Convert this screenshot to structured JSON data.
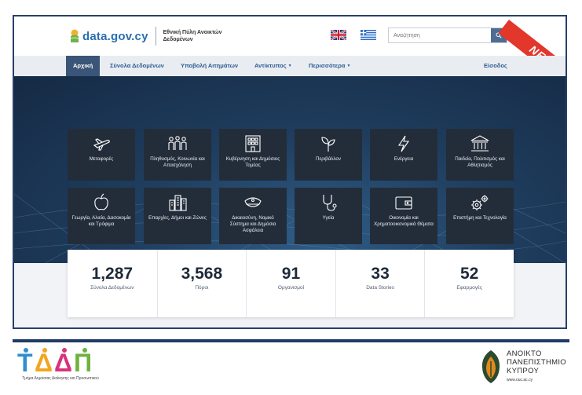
{
  "site": {
    "logo_text": "data.gov.cy",
    "logo_subtitle": "Εθνική Πύλη Ανοικτών Δεδομένων",
    "search_placeholder": "Αναζήτηση",
    "ribbon": "NEW"
  },
  "nav": {
    "items": [
      {
        "label": "Αρχική",
        "active": true
      },
      {
        "label": "Σύνολα Δεδομένων",
        "active": false
      },
      {
        "label": "Υποβολή Αιτημάτων",
        "active": false
      },
      {
        "label": "Αντίκτυπος",
        "active": false,
        "dropdown": true
      },
      {
        "label": "Περισσότερα",
        "active": false,
        "dropdown": true
      }
    ],
    "login": "Είσοδος"
  },
  "categories": [
    {
      "label": "Μεταφορές",
      "icon": "airplane-icon"
    },
    {
      "label": "Πληθυσμός, Κοινωνία και Απασχόληση",
      "icon": "people-icon"
    },
    {
      "label": "Κυβέρνηση και Δημόσιος Τομέας",
      "icon": "government-building-icon"
    },
    {
      "label": "Περιβάλλον",
      "icon": "plant-icon"
    },
    {
      "label": "Ενέργεια",
      "icon": "lightning-icon"
    },
    {
      "label": "Παιδεία, Πολιτισμός και Αθλητισμός",
      "icon": "museum-icon"
    },
    {
      "label": "Γεωργία, Αλιεία, Δασοκομία και Τρόφιμα",
      "icon": "apple-icon"
    },
    {
      "label": "Επαρχίες, Δήμοι και Ζώνες",
      "icon": "city-icon"
    },
    {
      "label": "Δικαιοσύνη, Νομικό Σύστημα και Δημόσια Ασφάλεια",
      "icon": "police-cap-icon"
    },
    {
      "label": "Υγεία",
      "icon": "stethoscope-icon"
    },
    {
      "label": "Οικονομία και Χρηματοοικονομικά Θέματα",
      "icon": "wallet-icon"
    },
    {
      "label": "Επιστήμη και Τεχνολογία",
      "icon": "gears-icon"
    }
  ],
  "stats": [
    {
      "value": "1,287",
      "label": "Σύνολα Δεδομένων"
    },
    {
      "value": "3,568",
      "label": "Πόροι"
    },
    {
      "value": "91",
      "label": "Οργανισμοί"
    },
    {
      "value": "33",
      "label": "Data Stories"
    },
    {
      "value": "52",
      "label": "Εφαρμογές"
    }
  ],
  "footer": {
    "left_logo_text": "ΤΔΔΠ",
    "left_caption": "Τμήμα Δημόσιας Διοίκησης και Προσωπικού",
    "right_name_lines": [
      "ΑΝΟΙΚΤΟ",
      "ΠΑΝΕΠΙΣΤΗΜΙΟ",
      "ΚΥΠΡΟΥ"
    ],
    "right_url": "www.ouc.ac.cy"
  },
  "colors": {
    "brand_blue": "#2a6fb0",
    "nav_active": "#3a5577",
    "tile_bg": "#232d3a",
    "ribbon_red": "#e3372b",
    "footer_navy": "#1f3b66"
  }
}
